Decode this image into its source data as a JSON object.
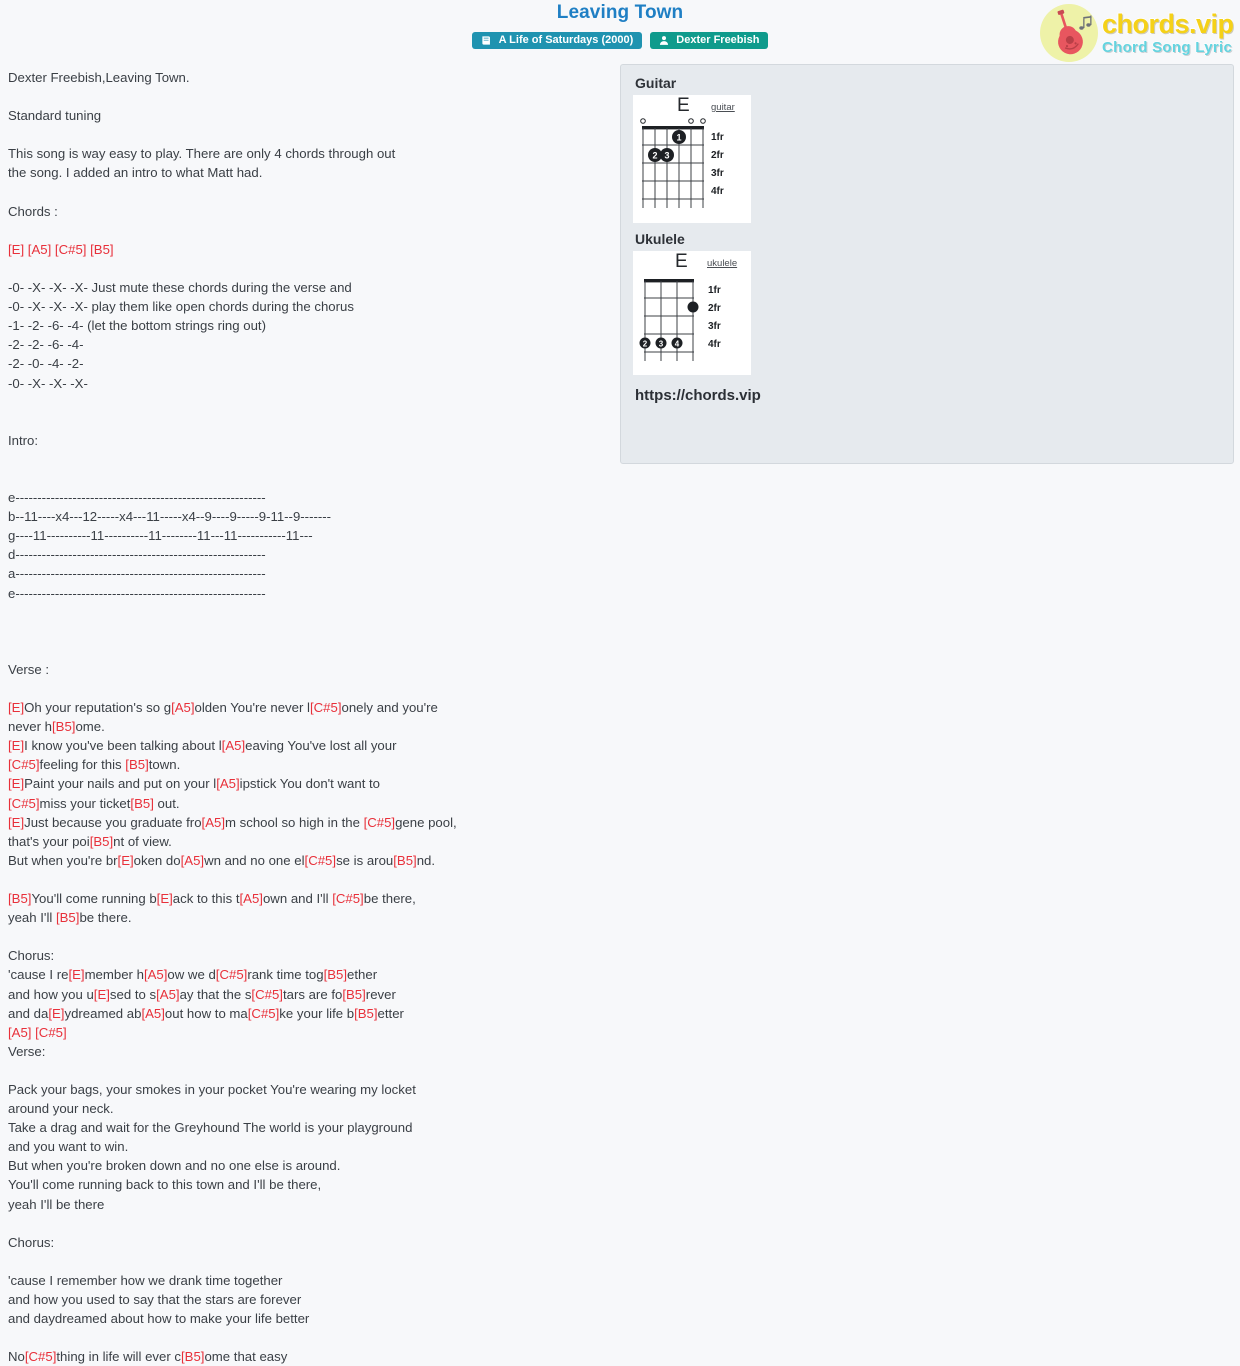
{
  "header": {
    "title": "Leaving Town",
    "badges": [
      {
        "icon": "album-icon",
        "label": "A Life of Saturdays (2000)",
        "color": "#1f93b0"
      },
      {
        "icon": "user-icon",
        "label": "Dexter Freebish",
        "color": "#0f9b8c"
      }
    ],
    "title_color": "#1f7fc4"
  },
  "logo": {
    "main": "chords.vip",
    "sub": "Chord Song Lyric",
    "main_color": "#f5d118",
    "sub_color": "#63d4e0",
    "circle_color": "#eef2a8",
    "guitar_color": "#e8565f",
    "notes_glyph": "♪♬"
  },
  "panel": {
    "guitar_heading": "Guitar",
    "ukulele_heading": "Ukulele",
    "url": "https://chords.vip",
    "guitar_chart": {
      "name": "E",
      "instrument_label": "guitar",
      "strings": 6,
      "frets": 4,
      "fret_labels": [
        "1fr",
        "2fr",
        "3fr",
        "4fr"
      ],
      "open_strings": [
        1,
        5,
        6
      ],
      "muted_strings": [],
      "dots": [
        {
          "string": 3,
          "fret": 1,
          "finger": "1"
        },
        {
          "string": 5,
          "fret": 2,
          "finger": "2"
        },
        {
          "string": 4,
          "fret": 2,
          "finger": "3"
        }
      ]
    },
    "ukulele_chart": {
      "name": "E",
      "instrument_label": "ukulele",
      "strings": 4,
      "frets": 4,
      "fret_labels": [
        "1fr",
        "2fr",
        "3fr",
        "4fr"
      ],
      "open_strings": [],
      "muted_strings": [],
      "dots": [
        {
          "string": 1,
          "fret": 2,
          "finger": ""
        },
        {
          "string": 4,
          "fret": 4,
          "finger": "2"
        },
        {
          "string": 3,
          "fret": 4,
          "finger": "3"
        },
        {
          "string": 2,
          "fret": 4,
          "finger": "4"
        }
      ]
    }
  },
  "lyrics": {
    "lines": [
      {
        "t": "Dexter Freebish,Leaving Town."
      },
      {
        "t": ""
      },
      {
        "t": "Standard tuning"
      },
      {
        "t": ""
      },
      {
        "t": "This song is way easy to play. There are only 4 chords through out"
      },
      {
        "t": "the song. I added an intro to what Matt had."
      },
      {
        "t": ""
      },
      {
        "t": "Chords :"
      },
      {
        "t": ""
      },
      {
        "parts": [
          {
            "c": "[E] "
          },
          {
            "c": "[A5] "
          },
          {
            "c": "[C#5] "
          },
          {
            "c": "[B5]"
          }
        ],
        "all_chord": true
      },
      {
        "t": ""
      },
      {
        "t": "-0- -X- -X- -X- Just mute these chords during the verse and"
      },
      {
        "t": "-0- -X- -X- -X- play them like open chords during the chorus"
      },
      {
        "t": "-1- -2- -6- -4- (let the bottom strings ring out)"
      },
      {
        "t": "-2- -2- -6- -4-"
      },
      {
        "t": "-2- -0- -4- -2-"
      },
      {
        "t": "-0- -X- -X- -X-"
      },
      {
        "t": ""
      },
      {
        "t": ""
      },
      {
        "t": "Intro:"
      },
      {
        "t": ""
      },
      {
        "t": ""
      },
      {
        "t": "e---------------------------------------------------------"
      },
      {
        "t": "b--11----x4---12-----x4---11-----x4--9----9-----9-11--9-------"
      },
      {
        "t": "g----11----------11----------11--------11---11-----------11---"
      },
      {
        "t": "d---------------------------------------------------------"
      },
      {
        "t": "a---------------------------------------------------------"
      },
      {
        "t": "e---------------------------------------------------------"
      },
      {
        "t": ""
      },
      {
        "t": ""
      },
      {
        "t": ""
      },
      {
        "t": "Verse :"
      },
      {
        "t": ""
      },
      {
        "parts": [
          {
            "c": "[E]"
          },
          {
            "p": "Oh your reputation's so g"
          },
          {
            "c": "[A5]"
          },
          {
            "p": "olden You're never l"
          },
          {
            "c": "[C#5]"
          },
          {
            "p": "onely and you're"
          }
        ]
      },
      {
        "parts": [
          {
            "p": "never h"
          },
          {
            "c": "[B5]"
          },
          {
            "p": "ome."
          }
        ]
      },
      {
        "parts": [
          {
            "c": "[E]"
          },
          {
            "p": "I know you've been talking about l"
          },
          {
            "c": "[A5]"
          },
          {
            "p": "eaving You've lost all your"
          }
        ]
      },
      {
        "parts": [
          {
            "c": "[C#5]"
          },
          {
            "p": "feeling for this "
          },
          {
            "c": "[B5]"
          },
          {
            "p": "town."
          }
        ]
      },
      {
        "parts": [
          {
            "c": "[E]"
          },
          {
            "p": "Paint your nails and put on your l"
          },
          {
            "c": "[A5]"
          },
          {
            "p": "ipstick You don't want to"
          }
        ]
      },
      {
        "parts": [
          {
            "c": "[C#5]"
          },
          {
            "p": "miss your ticket"
          },
          {
            "c": "[B5]"
          },
          {
            "p": " out."
          }
        ]
      },
      {
        "parts": [
          {
            "c": "[E]"
          },
          {
            "p": "Just because you graduate fro"
          },
          {
            "c": "[A5]"
          },
          {
            "p": "m school so high in the "
          },
          {
            "c": "[C#5]"
          },
          {
            "p": "gene pool,"
          }
        ]
      },
      {
        "parts": [
          {
            "p": "that's your poi"
          },
          {
            "c": "[B5]"
          },
          {
            "p": "nt of view."
          }
        ]
      },
      {
        "parts": [
          {
            "p": "But when you're br"
          },
          {
            "c": "[E]"
          },
          {
            "p": "oken do"
          },
          {
            "c": "[A5]"
          },
          {
            "p": "wn and no one el"
          },
          {
            "c": "[C#5]"
          },
          {
            "p": "se is arou"
          },
          {
            "c": "[B5]"
          },
          {
            "p": "nd."
          }
        ]
      },
      {
        "t": ""
      },
      {
        "parts": [
          {
            "c": "[B5]"
          },
          {
            "p": "You'll come running b"
          },
          {
            "c": "[E]"
          },
          {
            "p": "ack to this t"
          },
          {
            "c": "[A5]"
          },
          {
            "p": "own and I'll "
          },
          {
            "c": "[C#5]"
          },
          {
            "p": "be there,"
          }
        ]
      },
      {
        "parts": [
          {
            "p": "yeah I'll "
          },
          {
            "c": "[B5]"
          },
          {
            "p": "be there."
          }
        ]
      },
      {
        "t": ""
      },
      {
        "t": "Chorus:"
      },
      {
        "parts": [
          {
            "p": "'cause I re"
          },
          {
            "c": "[E]"
          },
          {
            "p": "member h"
          },
          {
            "c": "[A5]"
          },
          {
            "p": "ow we d"
          },
          {
            "c": "[C#5]"
          },
          {
            "p": "rank time tog"
          },
          {
            "c": "[B5]"
          },
          {
            "p": "ether"
          }
        ]
      },
      {
        "parts": [
          {
            "p": "and how you u"
          },
          {
            "c": "[E]"
          },
          {
            "p": "sed to s"
          },
          {
            "c": "[A5]"
          },
          {
            "p": "ay that the s"
          },
          {
            "c": "[C#5]"
          },
          {
            "p": "tars are fo"
          },
          {
            "c": "[B5]"
          },
          {
            "p": "rever"
          }
        ]
      },
      {
        "parts": [
          {
            "p": "and da"
          },
          {
            "c": "[E]"
          },
          {
            "p": "ydreamed ab"
          },
          {
            "c": "[A5]"
          },
          {
            "p": "out how to ma"
          },
          {
            "c": "[C#5]"
          },
          {
            "p": "ke your life b"
          },
          {
            "c": "[B5]"
          },
          {
            "p": "etter"
          }
        ]
      },
      {
        "parts": [
          {
            "c": "[A5] "
          },
          {
            "c": "[C#5]"
          }
        ]
      },
      {
        "t": "Verse:"
      },
      {
        "t": ""
      },
      {
        "t": "Pack your bags, your smokes in your pocket You're wearing my locket"
      },
      {
        "t": "around your neck."
      },
      {
        "t": "Take a drag and wait for the Greyhound The world is your playground"
      },
      {
        "t": "and you want to win."
      },
      {
        "t": "But when you're broken down and no one else is around."
      },
      {
        "t": "You'll come running back to this town and I'll be there,"
      },
      {
        "t": "yeah I'll be there"
      },
      {
        "t": ""
      },
      {
        "t": "Chorus:"
      },
      {
        "t": ""
      },
      {
        "t": "'cause I remember how we drank time together"
      },
      {
        "t": "and how you used to say that the stars are forever"
      },
      {
        "t": "and daydreamed about how to make your life better"
      },
      {
        "t": ""
      },
      {
        "parts": [
          {
            "p": "No"
          },
          {
            "c": "[C#5]"
          },
          {
            "p": "thing in life will ever c"
          },
          {
            "c": "[B5]"
          },
          {
            "p": "ome that easy"
          }
        ]
      }
    ]
  }
}
